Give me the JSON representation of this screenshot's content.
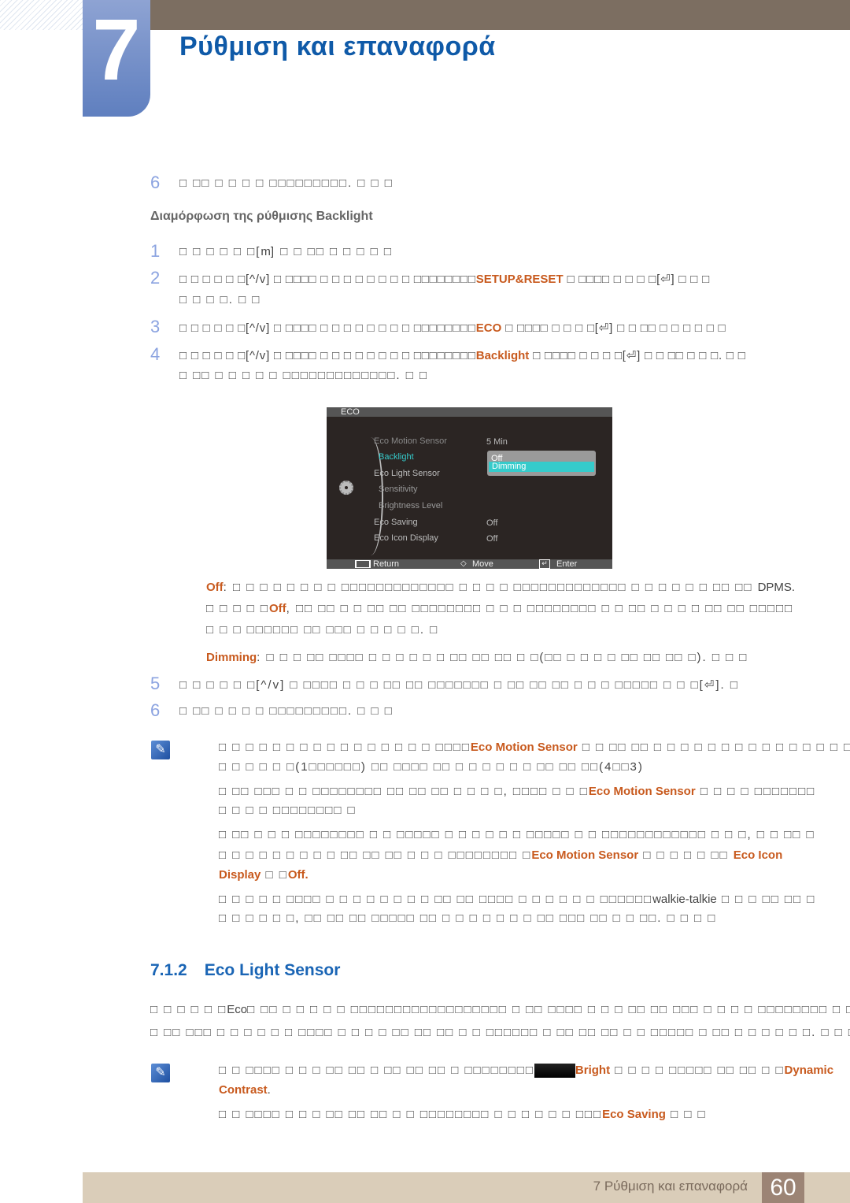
{
  "header": {
    "chapter_number": "7",
    "chapter_title": "Ρύθμιση και επαναφορά"
  },
  "steps_top": [
    {
      "num": "6",
      "text": "□ □□ □ □ □ □ □□□□□□□□□. □ □ □"
    }
  ],
  "subheading": "Διαμόρφωση της ρύθμισης Backlight",
  "steps": [
    {
      "num": "1",
      "pre": "□ □ □ □ □ □[",
      "key": "m",
      "post": "] □ □ □□ □ □ □ □ □"
    },
    {
      "num": "2",
      "pre": "□ □ □ □ □ □[^/v] □ □□□□ □ □ □ □ □ □ □ □ □□□□□□□□",
      "hl": "SETUP&RESET",
      "post": " □ □□□□ □ □ □ □[⏎] □ □ □",
      "line2": "□ □ □ □. □ □"
    },
    {
      "num": "3",
      "pre": "□ □ □ □ □ □[^/v] □ □□□□ □ □ □ □ □ □ □ □ □□□□□□□□",
      "hl": "ECO",
      "post": " □ □□□□ □ □ □ □[⏎] □ □ □□ □ □ □ □ □ □"
    },
    {
      "num": "4",
      "pre": "□ □ □ □ □ □[^/v] □ □□□□ □ □ □ □ □ □ □ □ □□□□□□□□",
      "hl": "Backlight",
      "post": " □ □□□□ □ □ □ □[⏎] □ □ □□ □ □ □. □ □",
      "line2": "□ □□ □ □ □ □ □ □□□□□□□□□□□□□. □ □"
    }
  ],
  "osd": {
    "title": "ECO",
    "items": [
      {
        "label": "Eco Motion Sensor",
        "value": "5 Min"
      },
      {
        "label": "Backlight",
        "value": ""
      },
      {
        "label": "Eco Light Sensor",
        "value": ""
      },
      {
        "label": "Sensitivity",
        "value": ""
      },
      {
        "label": "Brightness Level",
        "value": ""
      },
      {
        "label": "Eco Saving",
        "value": "Off"
      },
      {
        "label": "Eco Icon Display",
        "value": "Off"
      }
    ],
    "dropdown": {
      "options": [
        "Off",
        "Dimming"
      ],
      "selected": "Dimming"
    },
    "footer": {
      "return": "Return",
      "move": "Move",
      "enter": "Enter"
    },
    "colors": {
      "selected_item": "#35cbcb",
      "background": "#2b2523"
    }
  },
  "options": {
    "off_label": "Off",
    "off_line1": ": □ □ □ □ □ □ □ □ □□□□□□□□□□□□□ □ □ □ □ □□□□□□□□□□□□□ □ □ □ □ □ □ □□ □□",
    "off_dpms": "DPMS.",
    "off_line2_pre": "□ □ □ □ □",
    "off_line2_hl": "Off",
    "off_line2_post": ", □□ □□ □ □ □□ □□ □□□□□□□□ □ □ □ □□□□□□□□ □ □ □□ □ □ □ □ □□ □□ □□□□□",
    "off_line3": "□ □ □ □□□□□□ □□ □□□ □ □ □ □ □. □",
    "dimming_label": "Dimming",
    "dimming_text": ": □ □ □ □□ □□□□ □ □ □ □ □ □ □□ □□ □□ □ □(□□ □ □ □ □ □□ □□ □□ □). □ □ □"
  },
  "steps_after": [
    {
      "num": "5",
      "text": "□ □ □ □ □ □[^/v] □ □□□□ □ □ □ □□ □□ □□□□□□□ □ □□ □□ □□ □ □ □ □□□□□ □ □ □[⏎]. □"
    },
    {
      "num": "6",
      "text": "□ □□ □ □ □ □ □□□□□□□□□. □ □ □"
    }
  ],
  "note1": {
    "p1_pre": "□ □ □ □ □ □ □ □ □ □ □ □ □ □ □ □ □□□□",
    "p1_hl": "Eco Motion Sensor",
    "p1_post": " □ □ □□ □□ □ □ □ □ □ □ □ □ □ □ □ □ □ □ □ □ □",
    "p1_line2": "□ □ □ □ □ □(1□□□□□□) □□ □□□□ □□ □ □ □ □ □ □ □□ □□ □□(4□□3)",
    "p2_pre": "□ □□ □□□ □ □ □□□□□□□□ □□ □□ □□ □ □ □ □, □□□□ □ □ □",
    "p2_hl": "Eco Motion Sensor",
    "p2_post": " □ □ □ □ □□□□□□□",
    "p2_line2": "□ □ □ □ □□□□□□□□ □",
    "p3_line1": "□ □□ □ □ □ □□□□□□□□ □ □ □□□□□ □ □ □ □ □ □ □□□□□ □ □ □□□□□□□□□□□□ □ □ □, □ □ □□ □",
    "p3_line2_pre": "□ □ □ □ □ □ □ □ □ □□ □□ □□ □ □ □ □□□□□□□□ □",
    "p3_hl1": "Eco Motion Sensor",
    "p3_mid": " □ □ □ □ □ □□ ",
    "p3_hl2": "Eco Icon",
    "p3_line3_hl": "Display",
    "p3_line3_mid": " □ □",
    "p3_line3_hl2": "Off",
    "p4_line1_pre": "□ □ □ □ □ □□□□ □ □ □ □ □ □ □ □ □□ □□ □□□□ □ □ □ □ □ □ □□□□□□",
    "p4_walkie": "walkie-talkie",
    "p4_line1_post": " □ □ □ □□ □□ □",
    "p4_line2": "□ □ □ □ □ □, □□ □□ □□ □□□□□ □□ □ □ □ □ □ □ □ □□ □□□ □□ □ □ □□. □ □ □ □"
  },
  "section": {
    "number": "7.1.2",
    "title": "Eco Light Sensor",
    "p_line1_pre": "□ □ □ □ □ □",
    "p_eco": "Eco",
    "p_line1_post": "□ □□ □ □ □ □ □ □□□□□□□□□□□□□□□□□□ □ □□ □□□□ □ □ □ □□ □□ □□□ □ □ □ □ □□□□□□□□ □ □ □",
    "p_line2": "□ □□ □□□ □ □ □ □ □ □ □□□□ □ □ □ □ □□ □□ □□ □ □ □□□□□□ □ □□ □□ □□ □ □ □□□□□ □ □□ □ □ □ □ □ □. □ □ □ □"
  },
  "note2": {
    "p1_pre": "□ □ □□□□ □ □ □ □□ □□ □ □□ □□ □□ □ □□□□□□□□",
    "p1_hl1": "Bright",
    "p1_mid": " □ □ □ □ □□□□□ □□ □□ □ □",
    "p1_hl2": "Dynamic",
    "p1_line2_hl": "Contrast",
    "p2_pre": "□ □ □□□□ □ □ □ □□ □□ □□ □ □ □□□□□□□□ □ □ □ □ □ □ □□□",
    "p2_hl": "Eco Saving",
    "p2_post": " □ □ □"
  },
  "footer": {
    "label": "7 Ρύθμιση και επαναφορά",
    "page_number": "60"
  }
}
